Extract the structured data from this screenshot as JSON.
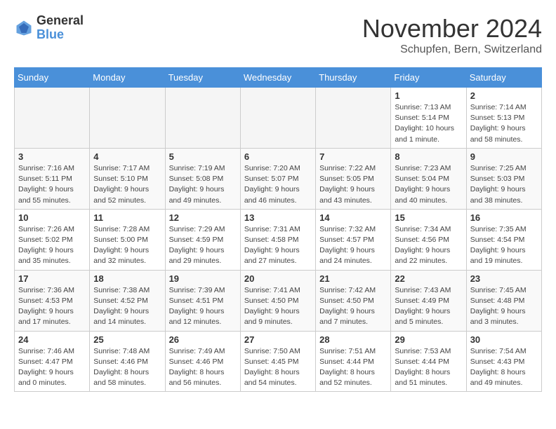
{
  "header": {
    "logo_general": "General",
    "logo_blue": "Blue",
    "month_title": "November 2024",
    "subtitle": "Schupfen, Bern, Switzerland"
  },
  "weekdays": [
    "Sunday",
    "Monday",
    "Tuesday",
    "Wednesday",
    "Thursday",
    "Friday",
    "Saturday"
  ],
  "weeks": [
    {
      "days": [
        {
          "num": "",
          "info": ""
        },
        {
          "num": "",
          "info": ""
        },
        {
          "num": "",
          "info": ""
        },
        {
          "num": "",
          "info": ""
        },
        {
          "num": "",
          "info": ""
        },
        {
          "num": "1",
          "info": "Sunrise: 7:13 AM\nSunset: 5:14 PM\nDaylight: 10 hours and 1 minute."
        },
        {
          "num": "2",
          "info": "Sunrise: 7:14 AM\nSunset: 5:13 PM\nDaylight: 9 hours and 58 minutes."
        }
      ]
    },
    {
      "days": [
        {
          "num": "3",
          "info": "Sunrise: 7:16 AM\nSunset: 5:11 PM\nDaylight: 9 hours and 55 minutes."
        },
        {
          "num": "4",
          "info": "Sunrise: 7:17 AM\nSunset: 5:10 PM\nDaylight: 9 hours and 52 minutes."
        },
        {
          "num": "5",
          "info": "Sunrise: 7:19 AM\nSunset: 5:08 PM\nDaylight: 9 hours and 49 minutes."
        },
        {
          "num": "6",
          "info": "Sunrise: 7:20 AM\nSunset: 5:07 PM\nDaylight: 9 hours and 46 minutes."
        },
        {
          "num": "7",
          "info": "Sunrise: 7:22 AM\nSunset: 5:05 PM\nDaylight: 9 hours and 43 minutes."
        },
        {
          "num": "8",
          "info": "Sunrise: 7:23 AM\nSunset: 5:04 PM\nDaylight: 9 hours and 40 minutes."
        },
        {
          "num": "9",
          "info": "Sunrise: 7:25 AM\nSunset: 5:03 PM\nDaylight: 9 hours and 38 minutes."
        }
      ]
    },
    {
      "days": [
        {
          "num": "10",
          "info": "Sunrise: 7:26 AM\nSunset: 5:02 PM\nDaylight: 9 hours and 35 minutes."
        },
        {
          "num": "11",
          "info": "Sunrise: 7:28 AM\nSunset: 5:00 PM\nDaylight: 9 hours and 32 minutes."
        },
        {
          "num": "12",
          "info": "Sunrise: 7:29 AM\nSunset: 4:59 PM\nDaylight: 9 hours and 29 minutes."
        },
        {
          "num": "13",
          "info": "Sunrise: 7:31 AM\nSunset: 4:58 PM\nDaylight: 9 hours and 27 minutes."
        },
        {
          "num": "14",
          "info": "Sunrise: 7:32 AM\nSunset: 4:57 PM\nDaylight: 9 hours and 24 minutes."
        },
        {
          "num": "15",
          "info": "Sunrise: 7:34 AM\nSunset: 4:56 PM\nDaylight: 9 hours and 22 minutes."
        },
        {
          "num": "16",
          "info": "Sunrise: 7:35 AM\nSunset: 4:54 PM\nDaylight: 9 hours and 19 minutes."
        }
      ]
    },
    {
      "days": [
        {
          "num": "17",
          "info": "Sunrise: 7:36 AM\nSunset: 4:53 PM\nDaylight: 9 hours and 17 minutes."
        },
        {
          "num": "18",
          "info": "Sunrise: 7:38 AM\nSunset: 4:52 PM\nDaylight: 9 hours and 14 minutes."
        },
        {
          "num": "19",
          "info": "Sunrise: 7:39 AM\nSunset: 4:51 PM\nDaylight: 9 hours and 12 minutes."
        },
        {
          "num": "20",
          "info": "Sunrise: 7:41 AM\nSunset: 4:50 PM\nDaylight: 9 hours and 9 minutes."
        },
        {
          "num": "21",
          "info": "Sunrise: 7:42 AM\nSunset: 4:50 PM\nDaylight: 9 hours and 7 minutes."
        },
        {
          "num": "22",
          "info": "Sunrise: 7:43 AM\nSunset: 4:49 PM\nDaylight: 9 hours and 5 minutes."
        },
        {
          "num": "23",
          "info": "Sunrise: 7:45 AM\nSunset: 4:48 PM\nDaylight: 9 hours and 3 minutes."
        }
      ]
    },
    {
      "days": [
        {
          "num": "24",
          "info": "Sunrise: 7:46 AM\nSunset: 4:47 PM\nDaylight: 9 hours and 0 minutes."
        },
        {
          "num": "25",
          "info": "Sunrise: 7:48 AM\nSunset: 4:46 PM\nDaylight: 8 hours and 58 minutes."
        },
        {
          "num": "26",
          "info": "Sunrise: 7:49 AM\nSunset: 4:46 PM\nDaylight: 8 hours and 56 minutes."
        },
        {
          "num": "27",
          "info": "Sunrise: 7:50 AM\nSunset: 4:45 PM\nDaylight: 8 hours and 54 minutes."
        },
        {
          "num": "28",
          "info": "Sunrise: 7:51 AM\nSunset: 4:44 PM\nDaylight: 8 hours and 52 minutes."
        },
        {
          "num": "29",
          "info": "Sunrise: 7:53 AM\nSunset: 4:44 PM\nDaylight: 8 hours and 51 minutes."
        },
        {
          "num": "30",
          "info": "Sunrise: 7:54 AM\nSunset: 4:43 PM\nDaylight: 8 hours and 49 minutes."
        }
      ]
    }
  ],
  "row_classes": [
    "row-bg-1",
    "row-bg-2",
    "row-bg-3",
    "row-bg-4",
    "row-bg-5"
  ]
}
